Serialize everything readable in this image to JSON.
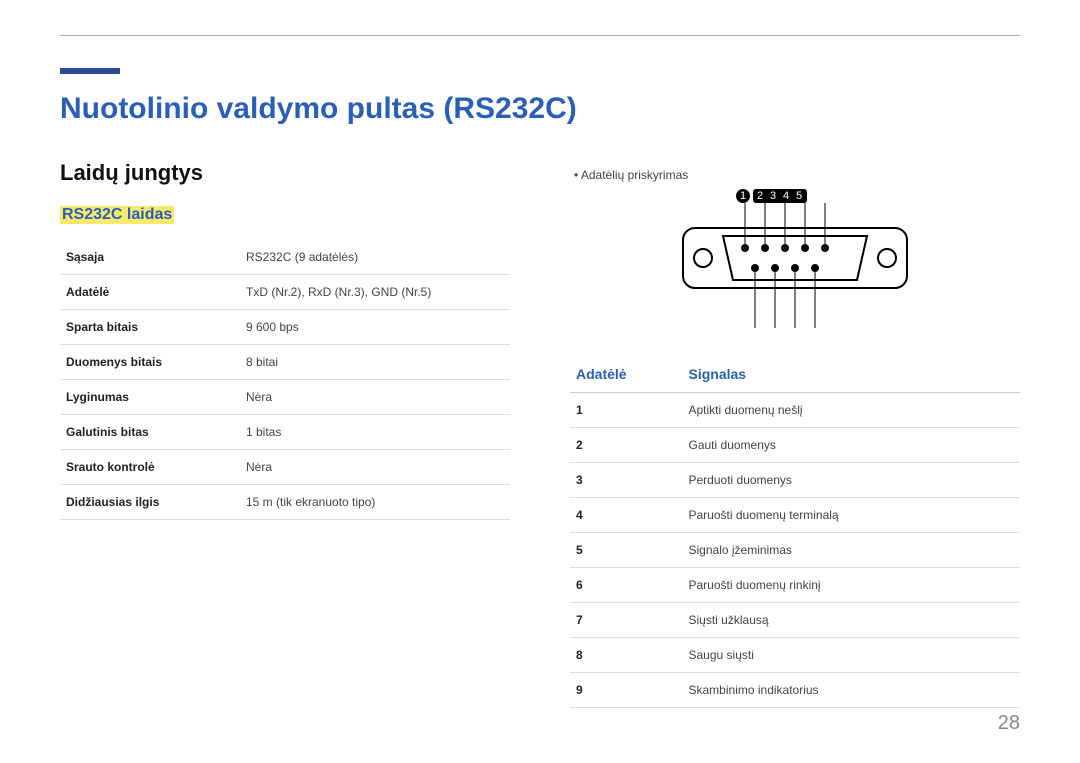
{
  "title": "Nuotolinio valdymo pultas (RS232C)",
  "section": "Laidų jungtys",
  "subsection": "RS232C laidas",
  "specs": [
    {
      "label": "Sąsaja",
      "value": "RS232C (9 adatėlės)"
    },
    {
      "label": "Adatėlė",
      "value": "TxD (Nr.2), RxD (Nr.3), GND (Nr.5)"
    },
    {
      "label": "Sparta bitais",
      "value": "9 600 bps"
    },
    {
      "label": "Duomenys bitais",
      "value": "8 bitai"
    },
    {
      "label": "Lyginumas",
      "value": "Nėra"
    },
    {
      "label": "Galutinis bitas",
      "value": "1 bitas"
    },
    {
      "label": "Srauto kontrolė",
      "value": "Nėra"
    },
    {
      "label": "Didžiausias ilgis",
      "value": "15 m (tik ekranuoto tipo)"
    }
  ],
  "right": {
    "bullet": "Adatėlių priskyrimas",
    "head_pin": "Adatėlė",
    "head_sig": "Signalas",
    "pins": [
      {
        "n": "1",
        "sig": "Aptikti duomenų nešlį"
      },
      {
        "n": "2",
        "sig": "Gauti duomenys"
      },
      {
        "n": "3",
        "sig": "Perduoti duomenys"
      },
      {
        "n": "4",
        "sig": "Paruošti duomenų terminalą"
      },
      {
        "n": "5",
        "sig": "Signalo įžeminimas"
      },
      {
        "n": "6",
        "sig": "Paruošti duomenų rinkinį"
      },
      {
        "n": "7",
        "sig": "Siųsti užklausą"
      },
      {
        "n": "8",
        "sig": "Saugu siųsti"
      },
      {
        "n": "9",
        "sig": "Skambinimo indikatorius"
      }
    ],
    "pin_labels": [
      "1",
      "2",
      "3",
      "4",
      "5"
    ]
  },
  "page_number": "28"
}
